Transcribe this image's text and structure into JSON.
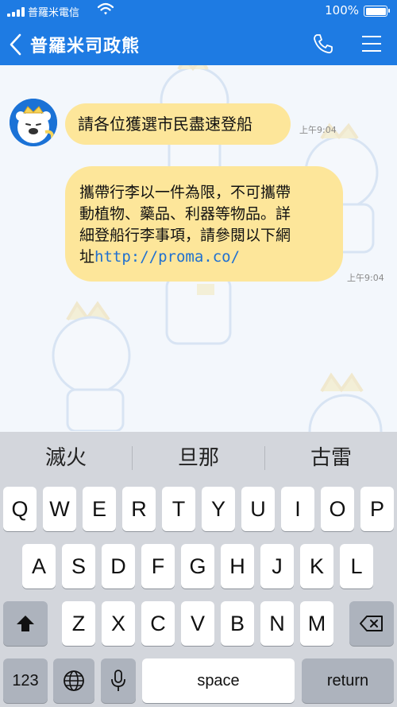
{
  "status_bar": {
    "carrier": "普羅米電信",
    "battery_percent": "100%",
    "battery_level": 1.0,
    "signal_icon": "signal-bars-icon",
    "wifi_icon": "wifi-icon"
  },
  "header": {
    "title": "普羅米司政熊",
    "back_icon": "chevron-left-icon",
    "call_icon": "phone-icon",
    "menu_icon": "hamburger-menu-icon",
    "color": "#1e7be3"
  },
  "messages": [
    {
      "text": "請各位獲選市民盡速登船",
      "time": "上午9:04"
    },
    {
      "text_lines": [
        "攜帶行李以一件為限，不可攜帶",
        "動植物、藥品、利器等物品。詳",
        "細登船行李事項，請參閱以下網"
      ],
      "last_prefix": "址",
      "link": "http://proma.co/",
      "time": "上午9:04"
    }
  ],
  "bubble_color": "#fde69a",
  "keyboard": {
    "suggestions": [
      "滅火",
      "旦那",
      "古雷"
    ],
    "row1": [
      "Q",
      "W",
      "E",
      "R",
      "T",
      "Y",
      "U",
      "I",
      "O",
      "P"
    ],
    "row2": [
      "A",
      "S",
      "D",
      "F",
      "G",
      "H",
      "J",
      "K",
      "L"
    ],
    "row3": [
      "Z",
      "X",
      "C",
      "V",
      "B",
      "N",
      "M"
    ],
    "numbers_label": "123",
    "space_label": "space",
    "return_label": "return",
    "shift_icon": "shift-icon",
    "delete_icon": "backspace-icon",
    "globe_icon": "globe-icon",
    "mic_icon": "microphone-icon"
  }
}
